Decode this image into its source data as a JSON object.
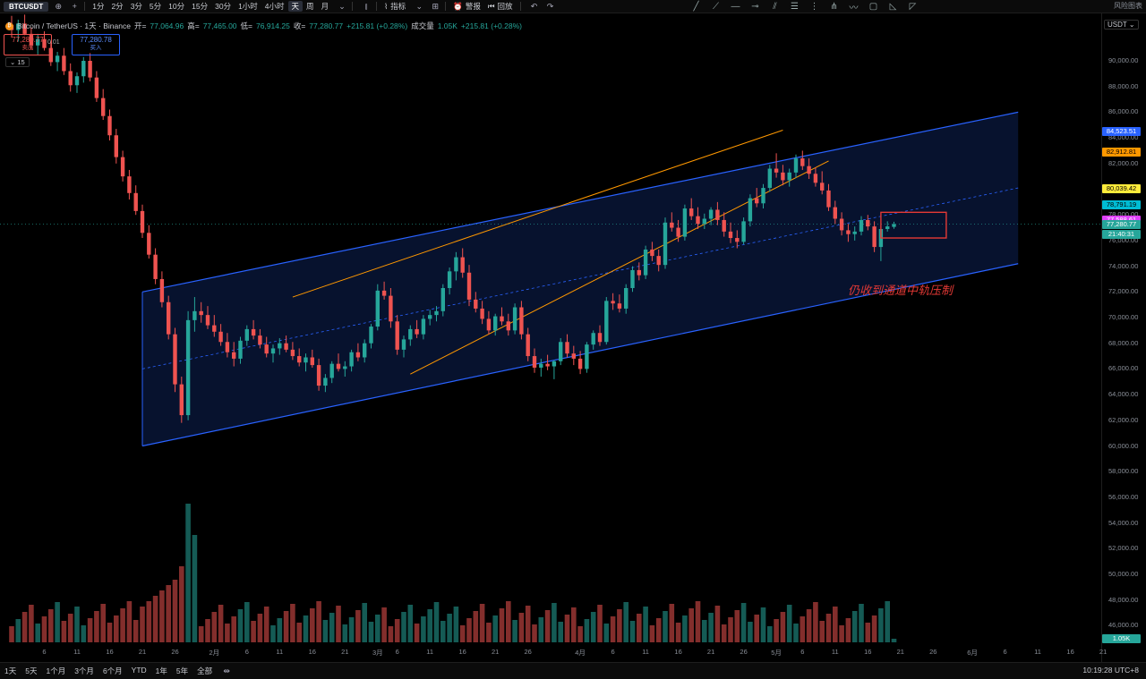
{
  "toolbar": {
    "symbol": "BTCUSDT",
    "timeframes": [
      "1分",
      "2分",
      "3分",
      "5分",
      "10分",
      "15分",
      "30分",
      "1小时",
      "4小时",
      "天",
      "周",
      "月"
    ],
    "active_timeframe": "天",
    "indicators_label": "指标",
    "alerts_label": "警报",
    "replay_label": "回放",
    "corner_label": "风险图表"
  },
  "legend": {
    "pair": "Bitcoin / TetherUS · 1天 · Binance",
    "open_label": "开=",
    "open": "77,064.96",
    "high_label": "高=",
    "high": "77,465.00",
    "low_label": "低=",
    "low": "76,914.25",
    "close_label": "收=",
    "close": "77,280.77",
    "change": "+215.81 (+0.28%)",
    "volume_label": "成交量",
    "volume": "1.05K",
    "volume_change": "+215.81 (+0.28%)"
  },
  "trade": {
    "sell_price": "77,280.77",
    "sell_label": "卖出",
    "buy_price": "77,280.78",
    "buy_label": "买入",
    "spread": "0.01",
    "interval": "15"
  },
  "price_axis": {
    "currency": "USDT",
    "labels": [
      "90,000.00",
      "88,000.00",
      "86,000.00",
      "84,000.00",
      "82,000.00",
      "80,000.00",
      "78,000.00",
      "76,000.00",
      "74,000.00",
      "72,000.00",
      "70,000.00",
      "68,000.00",
      "66,000.00",
      "64,000.00",
      "62,000.00",
      "60,000.00",
      "58,000.00",
      "56,000.00",
      "54,000.00",
      "52,000.00",
      "50,000.00",
      "48,000.00",
      "46,000.00"
    ],
    "tags": [
      {
        "text": "84,523.51",
        "color": "#2962ff",
        "price": 84523.51
      },
      {
        "text": "82,912.81",
        "color": "#ff9800",
        "price": 82912.81
      },
      {
        "text": "80,039.42",
        "color": "#ffeb3b",
        "price": 80039.42
      },
      {
        "text": "78,791.19",
        "color": "#00bcd4",
        "price": 78791.19
      },
      {
        "text": "77,588.61",
        "color": "#e040fb",
        "price": 77588.61
      },
      {
        "text": "77,280.77",
        "color": "#26a69a",
        "price": 77280.77
      },
      {
        "text": "21:40:31",
        "color": "#26a69a",
        "price": 76500
      }
    ],
    "volume_tag": "1.05K"
  },
  "time_axis": {
    "labels": [
      "6",
      "11",
      "16",
      "21",
      "26",
      "2月",
      "6",
      "11",
      "16",
      "21",
      "3月",
      "6",
      "11",
      "16",
      "21",
      "26",
      "4月",
      "6",
      "11",
      "16",
      "21",
      "26",
      "5月",
      "6",
      "11",
      "16",
      "21",
      "26",
      "6月",
      "6",
      "11",
      "16",
      "21"
    ]
  },
  "annotation": "仍收到通道中轨压制",
  "bottom": {
    "ranges": [
      "1天",
      "5天",
      "1个月",
      "3个月",
      "6个月",
      "YTD",
      "1年",
      "5年",
      "全部"
    ],
    "clock": "10:19:28 UTC+8"
  },
  "colors": {
    "up": "#26a69a",
    "down": "#ef5350",
    "channel": "#2962ff",
    "fan": "#ff9800",
    "annotation": "#e53935"
  },
  "chart_data": {
    "type": "candlestick",
    "date_range": [
      "2025-01-01",
      "2025-05-24"
    ],
    "series": [
      {
        "name": "BTCUSDT",
        "ohlc": [
          [
            92800,
            93500,
            91800,
            92400
          ],
          [
            92400,
            93200,
            91500,
            92900
          ],
          [
            92900,
            93600,
            92000,
            92100
          ],
          [
            92100,
            92600,
            90900,
            91200
          ],
          [
            91200,
            92100,
            90500,
            91700
          ],
          [
            91700,
            92300,
            90800,
            91000
          ],
          [
            91000,
            91500,
            89600,
            89900
          ],
          [
            89900,
            90700,
            89200,
            90400
          ],
          [
            90400,
            91000,
            88900,
            89200
          ],
          [
            89200,
            89800,
            87600,
            88100
          ],
          [
            88100,
            89100,
            87500,
            88800
          ],
          [
            88800,
            90300,
            88300,
            90000
          ],
          [
            90000,
            90600,
            88400,
            88700
          ],
          [
            88700,
            89200,
            86800,
            87100
          ],
          [
            87100,
            87800,
            85400,
            85700
          ],
          [
            85700,
            86200,
            83800,
            84200
          ],
          [
            84200,
            84700,
            82000,
            82500
          ],
          [
            82500,
            83000,
            80600,
            81000
          ],
          [
            81000,
            81500,
            79200,
            79700
          ],
          [
            79700,
            80300,
            78000,
            78300
          ],
          [
            78300,
            78800,
            76200,
            76600
          ],
          [
            76600,
            77200,
            74600,
            74900
          ],
          [
            74900,
            75400,
            72600,
            73000
          ],
          [
            73000,
            73600,
            70800,
            71200
          ],
          [
            71200,
            71700,
            68300,
            68700
          ],
          [
            68700,
            69200,
            64200,
            64800
          ],
          [
            64800,
            65400,
            61800,
            62400
          ],
          [
            62400,
            70500,
            62000,
            69800
          ],
          [
            69800,
            71600,
            68900,
            70500
          ],
          [
            70500,
            71200,
            69600,
            70200
          ],
          [
            70200,
            70900,
            69100,
            69400
          ],
          [
            69400,
            70200,
            68500,
            68900
          ],
          [
            68900,
            69500,
            67800,
            68100
          ],
          [
            68100,
            68800,
            66900,
            67300
          ],
          [
            67300,
            68100,
            66200,
            66800
          ],
          [
            66800,
            68500,
            66400,
            68200
          ],
          [
            68200,
            69400,
            67800,
            69100
          ],
          [
            69100,
            69800,
            68300,
            68600
          ],
          [
            68600,
            69100,
            67600,
            67900
          ],
          [
            67900,
            68500,
            66900,
            67200
          ],
          [
            67200,
            67900,
            66500,
            67600
          ],
          [
            67600,
            68400,
            67100,
            68000
          ],
          [
            68000,
            68600,
            67300,
            67500
          ],
          [
            67500,
            68100,
            66700,
            67000
          ],
          [
            67000,
            67600,
            66200,
            66500
          ],
          [
            66500,
            67200,
            65800,
            66900
          ],
          [
            66900,
            67500,
            66100,
            66300
          ],
          [
            66300,
            66800,
            64300,
            64700
          ],
          [
            64700,
            65600,
            64200,
            65300
          ],
          [
            65300,
            66600,
            64900,
            66400
          ],
          [
            66400,
            67200,
            65800,
            66000
          ],
          [
            66000,
            66600,
            65400,
            66200
          ],
          [
            66200,
            67500,
            65800,
            67300
          ],
          [
            67300,
            68000,
            66600,
            66900
          ],
          [
            66900,
            68300,
            66500,
            68000
          ],
          [
            68000,
            69500,
            67600,
            69300
          ],
          [
            69300,
            72600,
            69000,
            72100
          ],
          [
            72100,
            72800,
            71400,
            71700
          ],
          [
            71700,
            72300,
            69200,
            69700
          ],
          [
            69700,
            70200,
            67100,
            67500
          ],
          [
            67500,
            68600,
            66900,
            68300
          ],
          [
            68300,
            69400,
            67800,
            69100
          ],
          [
            69100,
            69800,
            68400,
            68700
          ],
          [
            68700,
            70200,
            68300,
            69900
          ],
          [
            69900,
            70600,
            69400,
            70200
          ],
          [
            70200,
            70900,
            69700,
            70500
          ],
          [
            70500,
            72600,
            70100,
            72300
          ],
          [
            72300,
            73900,
            71800,
            73600
          ],
          [
            73600,
            75100,
            72900,
            74700
          ],
          [
            74700,
            75400,
            73100,
            73500
          ],
          [
            73500,
            74100,
            70900,
            71400
          ],
          [
            71400,
            72000,
            70400,
            70700
          ],
          [
            70700,
            71300,
            69500,
            69900
          ],
          [
            69900,
            70500,
            68700,
            69000
          ],
          [
            69000,
            70300,
            68600,
            70100
          ],
          [
            70100,
            70800,
            69400,
            69700
          ],
          [
            69700,
            70300,
            68600,
            69000
          ],
          [
            69000,
            71100,
            68700,
            70800
          ],
          [
            70800,
            71300,
            68300,
            68700
          ],
          [
            68700,
            69200,
            66600,
            67000
          ],
          [
            67000,
            67600,
            65700,
            66100
          ],
          [
            66100,
            66800,
            65400,
            66400
          ],
          [
            66400,
            67100,
            65900,
            66200
          ],
          [
            66200,
            66700,
            65200,
            66600
          ],
          [
            66600,
            68400,
            66300,
            68100
          ],
          [
            68100,
            68700,
            66900,
            67200
          ],
          [
            67200,
            67800,
            66300,
            66800
          ],
          [
            66800,
            67400,
            65600,
            66000
          ],
          [
            66000,
            68100,
            65700,
            67900
          ],
          [
            67900,
            69000,
            67500,
            68800
          ],
          [
            68800,
            69400,
            67800,
            68100
          ],
          [
            68100,
            71600,
            67900,
            71300
          ],
          [
            71300,
            71900,
            70600,
            71100
          ],
          [
            71100,
            71800,
            70400,
            70700
          ],
          [
            70700,
            72600,
            70300,
            72300
          ],
          [
            72300,
            74000,
            72000,
            73700
          ],
          [
            73700,
            74300,
            72900,
            73300
          ],
          [
            73300,
            75600,
            73000,
            75300
          ],
          [
            75300,
            75900,
            74400,
            74800
          ],
          [
            74800,
            75300,
            73600,
            74100
          ],
          [
            74100,
            77800,
            73800,
            77400
          ],
          [
            77400,
            78200,
            76700,
            77000
          ],
          [
            77000,
            77600,
            75900,
            76300
          ],
          [
            76300,
            78800,
            76000,
            78500
          ],
          [
            78500,
            79300,
            77600,
            77900
          ],
          [
            77900,
            78600,
            76900,
            77300
          ],
          [
            77300,
            78100,
            76900,
            77700
          ],
          [
            77700,
            78600,
            77200,
            78400
          ],
          [
            78400,
            79000,
            77200,
            77600
          ],
          [
            77600,
            78200,
            76300,
            76700
          ],
          [
            76700,
            77400,
            75800,
            76200
          ],
          [
            76200,
            76800,
            75400,
            75900
          ],
          [
            75900,
            77800,
            75700,
            77500
          ],
          [
            77500,
            79600,
            77100,
            79300
          ],
          [
            79300,
            80100,
            78600,
            78900
          ],
          [
            78900,
            80400,
            78500,
            80100
          ],
          [
            80100,
            81900,
            79800,
            81600
          ],
          [
            81600,
            82800,
            80900,
            81300
          ],
          [
            81300,
            81900,
            80300,
            80700
          ],
          [
            80700,
            81600,
            80200,
            81300
          ],
          [
            81300,
            82700,
            80900,
            82400
          ],
          [
            82400,
            83000,
            81500,
            81800
          ],
          [
            81800,
            82400,
            80800,
            81200
          ],
          [
            81200,
            81700,
            80200,
            80500
          ],
          [
            80500,
            81400,
            79600,
            79900
          ],
          [
            79900,
            80400,
            78300,
            78600
          ],
          [
            78600,
            79100,
            77300,
            77700
          ],
          [
            77700,
            78200,
            76400,
            76800
          ],
          [
            76800,
            77300,
            75900,
            76500
          ],
          [
            76500,
            77100,
            76000,
            76700
          ],
          [
            76700,
            77900,
            76400,
            77600
          ],
          [
            77600,
            78000,
            76800,
            77100
          ],
          [
            77100,
            77500,
            75100,
            75500
          ],
          [
            75500,
            77200,
            74400,
            76900
          ],
          [
            76900,
            77500,
            76700,
            77100
          ],
          [
            77064.96,
            77465,
            76914.25,
            77280.77
          ]
        ]
      }
    ],
    "channel": {
      "upper": [
        [
          20,
          72000
        ],
        [
          154,
          86000
        ]
      ],
      "lower": [
        [
          20,
          60000
        ],
        [
          154,
          74200
        ]
      ]
    },
    "fan_upper": [
      [
        43,
        71600
      ],
      [
        118,
        84600
      ]
    ],
    "fan_lower": [
      [
        61,
        65600
      ],
      [
        125,
        82200
      ]
    ],
    "box": {
      "x": [
        133,
        143
      ],
      "y": [
        76200,
        78200
      ]
    },
    "ylim": [
      45000,
      92000
    ]
  }
}
